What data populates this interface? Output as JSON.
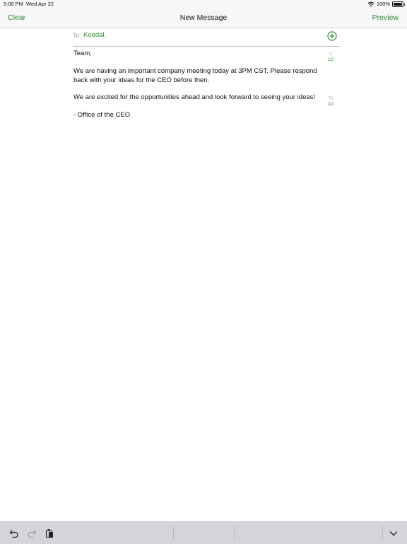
{
  "status": {
    "time": "5:06 PM",
    "date": "Wed Apr 22",
    "battery": "100%"
  },
  "nav": {
    "left": "Clear",
    "title": "New Message",
    "right": "Preview"
  },
  "compose": {
    "to_label": "To:",
    "recipient": "Koedal",
    "recipient_separator": ","
  },
  "message": {
    "greeting": "Team,",
    "paragraph1": "We are having an important company meeting today at 3PM CST. Please respond back with your ideas for the CEO before then.",
    "paragraph2": "We are excited for the opportunities ahead and look forward to seeing your ideas!",
    "signature": "- Office of the CEO"
  },
  "counters": [
    {
      "chars": "0",
      "segment": "1/2"
    },
    {
      "chars": "75",
      "segment": "2/2"
    }
  ],
  "colors": {
    "accent": "#2a8c2f",
    "toolbar_bg": "#d3d5da"
  },
  "icons": {
    "undo": "undo-icon",
    "redo": "redo-icon",
    "paste": "paste-icon",
    "dismiss_keyboard": "chevron-down-icon",
    "add_recipient": "plus-circle-icon"
  }
}
